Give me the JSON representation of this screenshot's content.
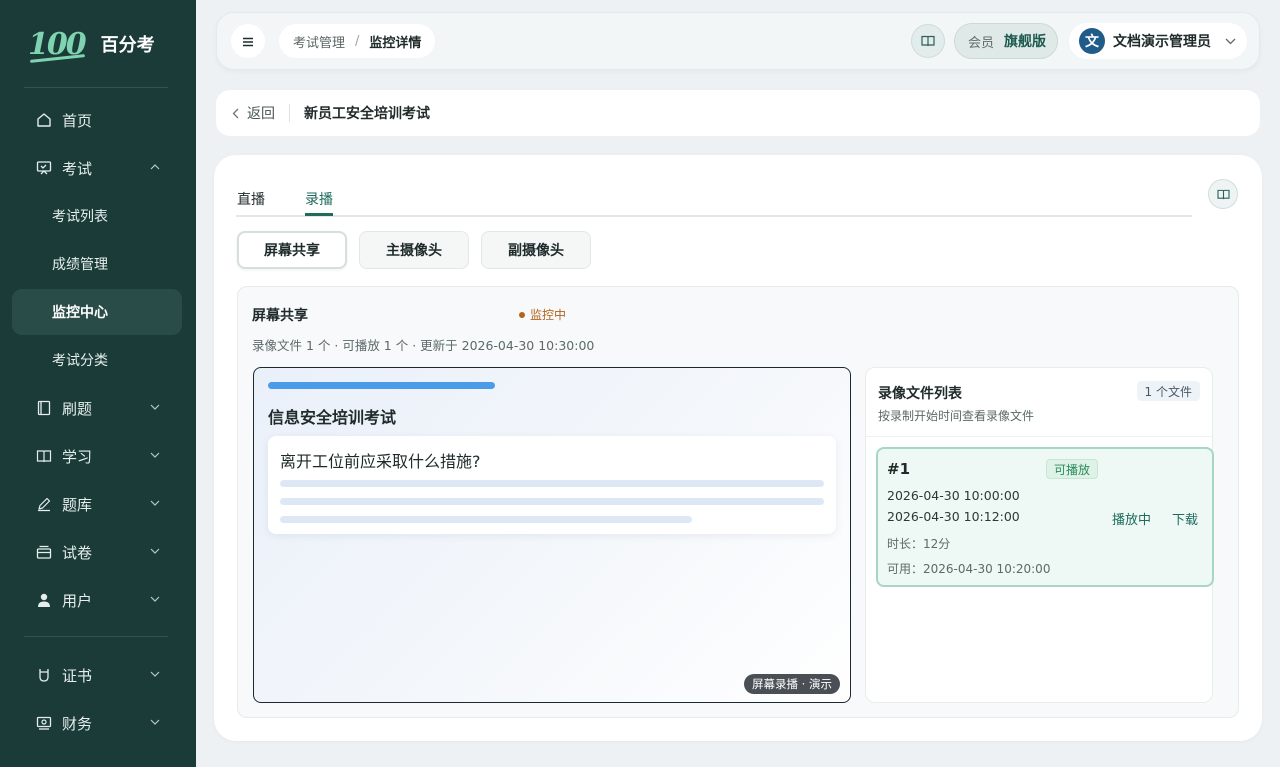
{
  "brand": {
    "logo_text": "100",
    "name": "百分考"
  },
  "sidebar": {
    "items": [
      {
        "label": "首页",
        "icon": "home-icon"
      },
      {
        "label": "考试",
        "icon": "exam-board-icon"
      },
      {
        "label": "考试列表"
      },
      {
        "label": "成绩管理"
      },
      {
        "label": "监控中心"
      },
      {
        "label": "考试分类"
      },
      {
        "label": "刷题",
        "icon": "notebook-icon"
      },
      {
        "label": "学习",
        "icon": "book-icon"
      },
      {
        "label": "题库",
        "icon": "pen-icon"
      },
      {
        "label": "试卷",
        "icon": "paper-tray-icon"
      },
      {
        "label": "用户",
        "icon": "user-icon"
      },
      {
        "label": "证书",
        "icon": "certificate-icon"
      },
      {
        "label": "财务",
        "icon": "finance-icon"
      }
    ],
    "active_item": "监控中心"
  },
  "topbar": {
    "breadcrumb": [
      "考试管理",
      "/",
      "监控详情"
    ],
    "member_label": "会员",
    "member_level": "旗舰版",
    "user_avatar": "文",
    "user_name": "文档演示管理员"
  },
  "backbar": {
    "back_label": "返回",
    "exam_title": "新员工安全培训考试"
  },
  "tabs": [
    {
      "label": "直播"
    },
    {
      "label": "录播"
    }
  ],
  "active_tab": "录播",
  "camera_buttons": [
    {
      "label": "屏幕共享"
    },
    {
      "label": "主摄像头"
    },
    {
      "label": "副摄像头"
    }
  ],
  "active_camera": "屏幕共享",
  "panel": {
    "title": "屏幕共享",
    "status": "监控中",
    "meta": "录像文件 1 个 · 可播放 1 个 · 更新于 2026-04-30 10:30:00"
  },
  "viewer": {
    "progress_fraction": 0.4,
    "title": "信息安全培训考试",
    "question": "离开工位前应采取什么措施?",
    "tag": "屏幕录播 · 演示"
  },
  "files": {
    "title": "录像文件列表",
    "count": "1 个文件",
    "subtitle": "按录制开始时间查看录像文件",
    "records": [
      {
        "id": "#1",
        "badge": "可播放",
        "start": "2026-04-30 10:00:00",
        "end": "2026-04-30 10:12:00",
        "duration": "时长：12分",
        "available": "可用：2026-04-30 10:20:00",
        "play_label": "播放中",
        "download_label": "下载"
      }
    ]
  },
  "colors": {
    "sidebar_bg": "#1a3b38",
    "accent": "#1f6b5c",
    "status_orange": "#b3641c",
    "record_border": "#a8d6c6"
  }
}
